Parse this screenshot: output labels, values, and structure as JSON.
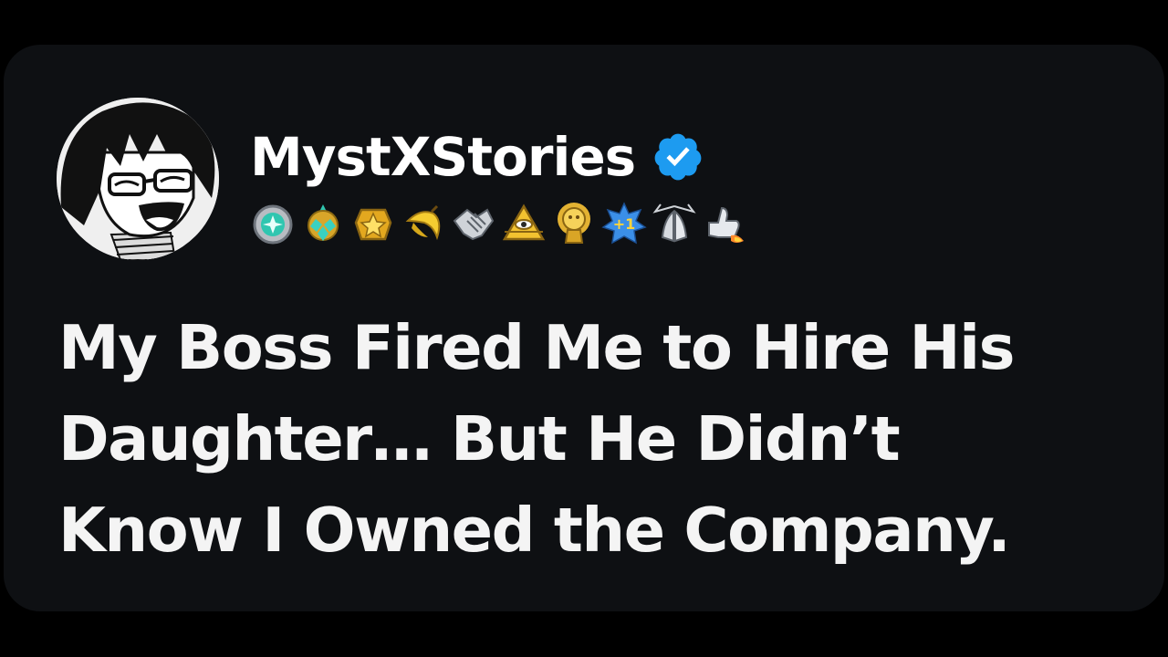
{
  "post": {
    "username": "MystXStories",
    "verified": true,
    "accent_color": "#1d9bf0",
    "avatar_icon": "anime-boy-laughing-avatar",
    "badges": [
      "silver-medal-badge-icon",
      "triple-gem-badge-icon",
      "gold-star-badge-icon",
      "banana-badge-icon",
      "handshake-badge-icon",
      "pyramid-eye-badge-icon",
      "golden-idol-badge-icon",
      "plus-one-badge-icon",
      "praying-hands-badge-icon",
      "thumbs-up-rocket-badge-icon"
    ],
    "headline_lines": [
      "My Boss Fired Me to Hire His",
      "Daughter… But He Didn’t",
      "Know I Owned the Company."
    ]
  }
}
